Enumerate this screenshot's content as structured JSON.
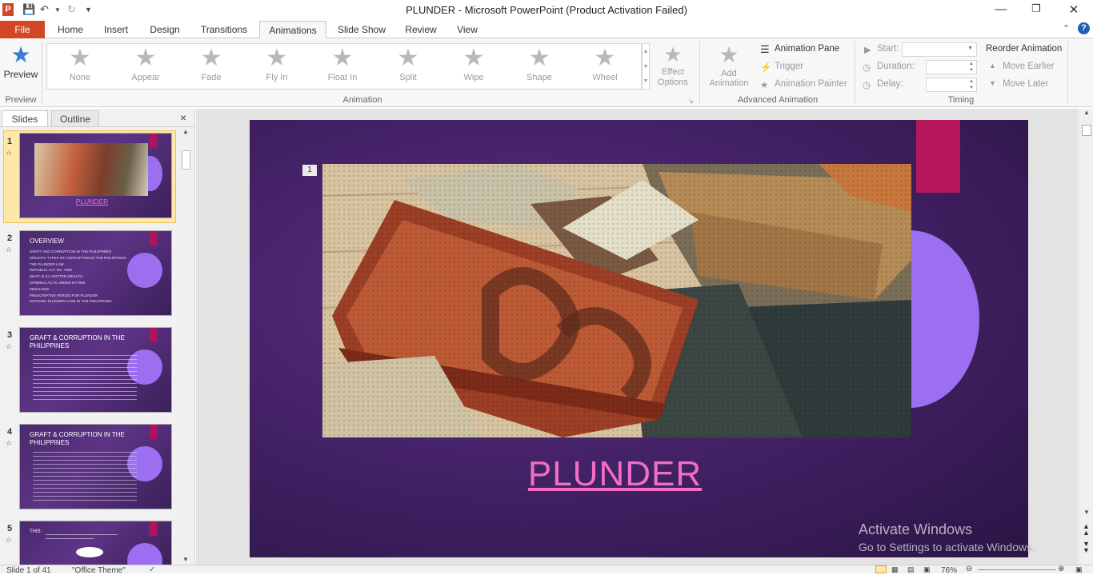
{
  "window": {
    "title": "PLUNDER - Microsoft PowerPoint (Product Activation Failed)",
    "app_icon": "P"
  },
  "tabs": [
    {
      "label": "File"
    },
    {
      "label": "Home"
    },
    {
      "label": "Insert"
    },
    {
      "label": "Design"
    },
    {
      "label": "Transitions"
    },
    {
      "label": "Animations"
    },
    {
      "label": "Slide Show"
    },
    {
      "label": "Review"
    },
    {
      "label": "View"
    }
  ],
  "ribbon": {
    "preview": {
      "button": "Preview",
      "group": "Preview"
    },
    "animations": [
      "None",
      "Appear",
      "Fade",
      "Fly In",
      "Float In",
      "Split",
      "Wipe",
      "Shape",
      "Wheel"
    ],
    "effect_options": "Effect Options",
    "animation_group": "Animation",
    "add_animation": "Add Animation",
    "animation_pane": "Animation Pane",
    "trigger": "Trigger",
    "animation_painter": "Animation Painter",
    "advanced_group": "Advanced Animation",
    "start": "Start:",
    "duration": "Duration:",
    "delay": "Delay:",
    "timing_group": "Timing",
    "reorder": "Reorder Animation",
    "move_earlier": "Move Earlier",
    "move_later": "Move Later"
  },
  "panel": {
    "tab_slides": "Slides",
    "tab_outline": "Outline",
    "close": "×",
    "thumbs": [
      {
        "num": "1",
        "title": "PLUNDER"
      },
      {
        "num": "2",
        "title": "OVERVIEW",
        "bullets": [
          "GRAFT AND CORRUPTION IN THE PHILIPPINES",
          "SPECIFIC TYPES OF CORRUPTION IN THE PHILIPPINES",
          "THE PLUNDER LAW",
          "REPUBLIC ACT NO. 7080",
          "WHAT IS ILL-GOTTEN WEALTH",
          "CRIMINAL ACTS UNDER RA7080",
          "PENALTIES",
          "PRESCRIPTIVE PERIOD FOR PLUNDER",
          "HISTORIC PLUNDER CASE IN THE PHILIPPINES"
        ]
      },
      {
        "num": "3",
        "title": "GRAFT & CORRUPTION IN THE PHILIPPINES"
      },
      {
        "num": "4",
        "title": "GRAFT & CORRUPTION IN THE PHILIPPINES"
      },
      {
        "num": "5",
        "title": "THIS"
      }
    ]
  },
  "slide": {
    "number": "1",
    "title": "PLUNDER"
  },
  "watermark": {
    "line1": "Activate Windows",
    "line2": "Go to Settings to activate Windows."
  },
  "status": {
    "slide_info": "Slide 1 of 41",
    "theme": "\"Office Theme\"",
    "zoom": "76%"
  },
  "colors": {
    "file_tab": "#d24726",
    "slide_bg": "#452268",
    "accent_pink": "#b6165c",
    "accent_circle": "#9b6ff0",
    "title_pink": "#f06ec4"
  }
}
